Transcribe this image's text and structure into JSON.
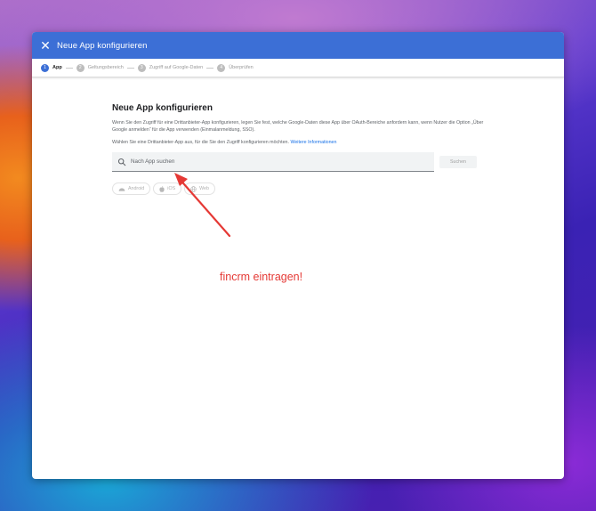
{
  "window": {
    "title": "Neue App konfigurieren",
    "close_glyph": "✕"
  },
  "stepper": {
    "steps": [
      {
        "num": "1",
        "label": "App"
      },
      {
        "num": "2",
        "label": "Geltungsbereich"
      },
      {
        "num": "3",
        "label": "Zugriff auf Google-Daten"
      },
      {
        "num": "4",
        "label": "Überprüfen"
      }
    ],
    "active_step": 1
  },
  "content": {
    "heading": "Neue App konfigurieren",
    "description": "Wenn Sie den Zugriff für eine Drittanbieter-App konfigurieren, legen Sie fest, welche Google-Daten diese App über OAuth-Bereiche anfordern kann, wenn Nutzer die Option „Über Google anmelden“ für die App verwenden (Einmalanmeldung, SSO).",
    "select_text": "Wählen Sie eine Drittanbieter-App aus, für die Sie den Zugriff konfigurieren möchten.",
    "more_info_link": "Weitere Informationen",
    "search": {
      "placeholder": "Nach App suchen",
      "value": "",
      "button_label": "Suchen",
      "icon": "search-icon"
    },
    "platform_chips": [
      {
        "label": "Android",
        "icon": "android-icon"
      },
      {
        "label": "iOS",
        "icon": "apple-icon"
      },
      {
        "label": "Web",
        "icon": "globe-icon"
      }
    ]
  },
  "annotation": {
    "text": "fincrm eintragen!",
    "color": "#e53935"
  },
  "colors": {
    "accent": "#3c6fd6",
    "link": "#1a73e8"
  }
}
